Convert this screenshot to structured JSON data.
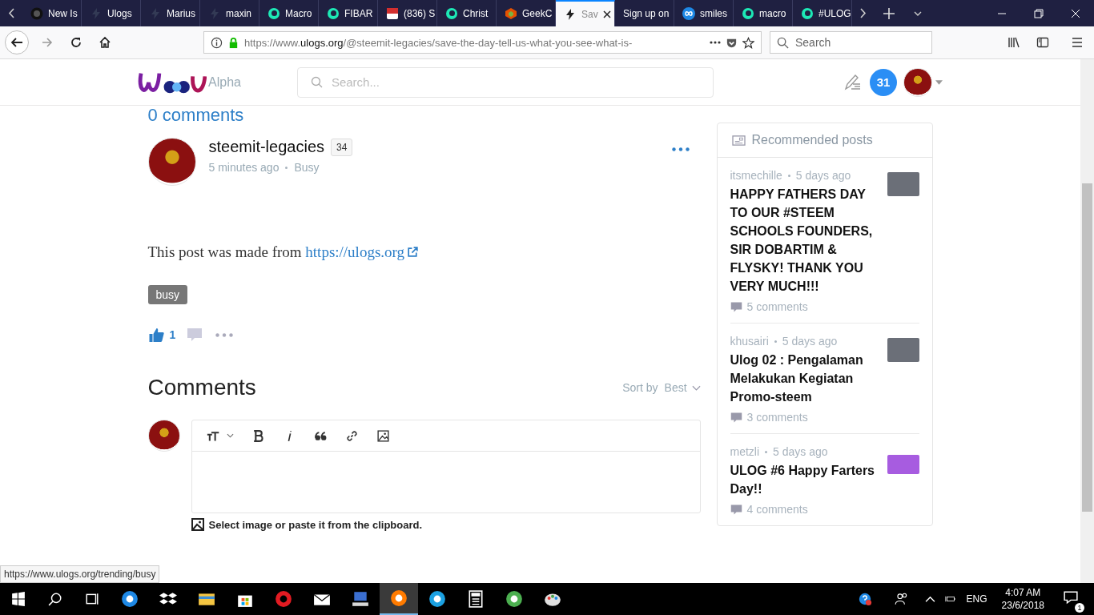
{
  "browser": {
    "tabs": [
      {
        "title": "New Is",
        "kind": "github",
        "selected": false
      },
      {
        "title": "Ulogs",
        "kind": "bolt",
        "selected": false
      },
      {
        "title": "Marius",
        "kind": "bolt",
        "selected": false
      },
      {
        "title": "maxin",
        "kind": "bolt",
        "selected": false
      },
      {
        "title": "Macro",
        "kind": "steem",
        "selected": false
      },
      {
        "title": "FIBAR",
        "kind": "steem",
        "selected": false
      },
      {
        "title": "(836) S",
        "kind": "badge",
        "selected": false
      },
      {
        "title": "Christ",
        "kind": "steem",
        "selected": false
      },
      {
        "title": "GeekC",
        "kind": "cube",
        "selected": false
      },
      {
        "title": "Sav",
        "kind": "bolt",
        "selected": true
      },
      {
        "title": "Sign up on",
        "kind": "plain",
        "selected": false
      },
      {
        "title": "smiles",
        "kind": "infinity",
        "selected": false
      },
      {
        "title": "macro",
        "kind": "steem",
        "selected": false
      },
      {
        "title": "#ULOG",
        "kind": "steem",
        "selected": false
      }
    ],
    "address": {
      "url_scheme": "https://www.",
      "url_host": "ulogs.org",
      "url_path": "/@steemit-legacies/save-the-day-tell-us-what-you-see-what-is-"
    },
    "search": {
      "placeholder": "Search"
    },
    "status_link": "https://www.ulogs.org/trending/busy"
  },
  "site": {
    "logo_tag": "Alpha",
    "search": {
      "placeholder": "Search..."
    },
    "notifications": "31"
  },
  "post": {
    "comments_count": "0 comments",
    "author": "steemit-legacies",
    "reputation": "34",
    "time": "5 minutes ago",
    "app": "Busy",
    "body": "This post was made from",
    "link": "https://ulogs.org",
    "tag": "busy",
    "likes": "1"
  },
  "comments": {
    "title": "Comments",
    "sort_label": "Sort by",
    "sort_value": "Best",
    "upload_hint": "Select image or paste it from the clipboard."
  },
  "sidebar": {
    "title": "Recommended posts",
    "posts": [
      {
        "author": "itsmechille",
        "time": "5 days ago",
        "title": "HAPPY FATHERS DAY TO OUR #STEEM SCHOOLS FOUNDERS, SIR DOBARTIM & FLYSKY! THANK YOU VERY MUCH!!!",
        "comments": "5 comments"
      },
      {
        "author": "khusairi",
        "time": "5 days ago",
        "title": "Ulog 02 : Pengalaman Melakukan Kegiatan Promo-steem",
        "comments": "3 comments"
      },
      {
        "author": "metzli",
        "time": "5 days ago",
        "title": "ULOG #6 Happy Farters Day!!",
        "comments": "4 comments"
      }
    ]
  },
  "taskbar": {
    "apps": [
      {
        "kind": "edge",
        "selected": false
      },
      {
        "kind": "dropbox",
        "selected": false
      },
      {
        "kind": "explorer",
        "selected": false
      },
      {
        "kind": "store",
        "selected": false
      },
      {
        "kind": "opera",
        "selected": false
      },
      {
        "kind": "mail",
        "selected": false
      },
      {
        "kind": "network",
        "selected": false
      },
      {
        "kind": "firefox",
        "selected": true
      },
      {
        "kind": "skype",
        "selected": false
      },
      {
        "kind": "calculator",
        "selected": false
      },
      {
        "kind": "chrome",
        "selected": false
      },
      {
        "kind": "paint",
        "selected": false
      }
    ],
    "language": "ENG",
    "time": "4:07 AM",
    "date": "23/6/2018",
    "notification_count": "1"
  }
}
